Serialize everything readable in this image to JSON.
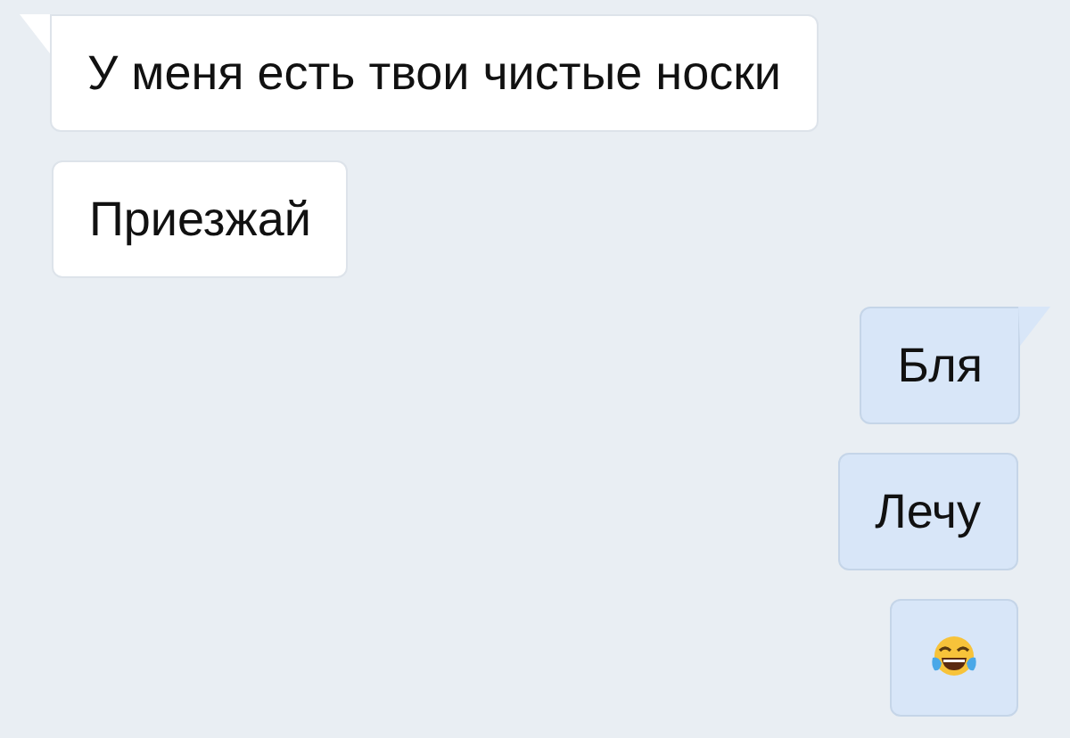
{
  "messages": [
    {
      "outgoing": false,
      "tail": true,
      "kind": "text",
      "text": "У меня есть твои чистые носки"
    },
    {
      "outgoing": false,
      "tail": false,
      "kind": "text",
      "text": "Приезжай"
    },
    {
      "outgoing": true,
      "tail": true,
      "kind": "text",
      "text": "Бля"
    },
    {
      "outgoing": true,
      "tail": false,
      "kind": "text",
      "text": "Лечу"
    },
    {
      "outgoing": true,
      "tail": false,
      "kind": "emoji"
    }
  ]
}
